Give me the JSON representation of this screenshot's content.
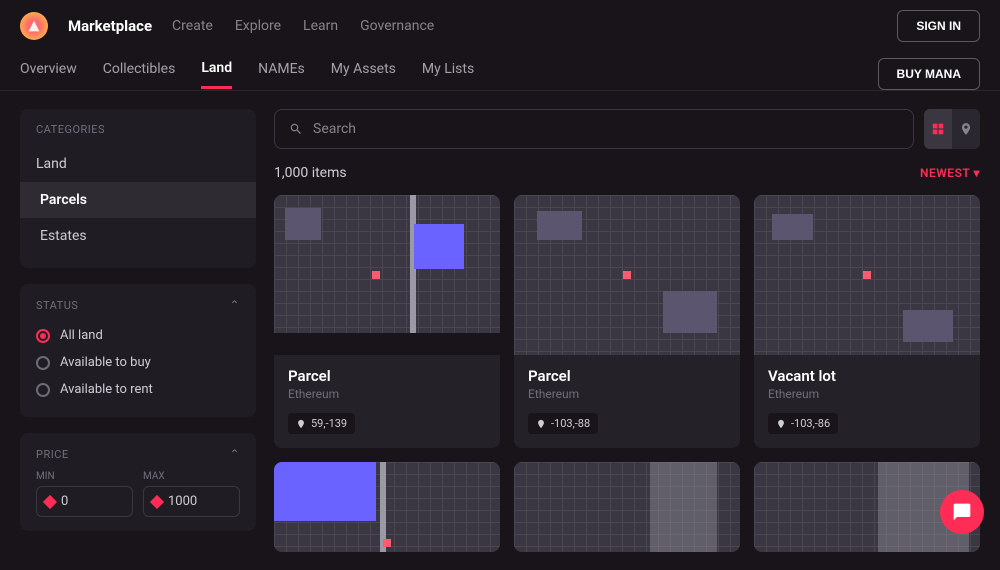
{
  "header": {
    "brand": "Marketplace",
    "nav": [
      "Create",
      "Explore",
      "Learn",
      "Governance"
    ],
    "signin": "SIGN IN"
  },
  "subnav": {
    "tabs": [
      "Overview",
      "Collectibles",
      "Land",
      "NAMEs",
      "My Assets",
      "My Lists"
    ],
    "active": "Land",
    "buy": "BUY MANA"
  },
  "sidebar": {
    "categories_title": "CATEGORIES",
    "categories": [
      {
        "label": "Land",
        "active": false
      },
      {
        "label": "Parcels",
        "active": true
      },
      {
        "label": "Estates",
        "active": false
      }
    ],
    "status_title": "STATUS",
    "status_options": [
      {
        "label": "All land",
        "selected": true
      },
      {
        "label": "Available to buy",
        "selected": false
      },
      {
        "label": "Available to rent",
        "selected": false
      }
    ],
    "price_title": "PRICE",
    "price_min_label": "MIN",
    "price_max_label": "MAX",
    "price_min": "0",
    "price_max": "1000"
  },
  "search": {
    "placeholder": "Search"
  },
  "results": {
    "count": "1,000 items",
    "sort": "NEWEST"
  },
  "cards": [
    {
      "title": "Parcel",
      "chain": "Ethereum",
      "coord": "59,-139"
    },
    {
      "title": "Parcel",
      "chain": "Ethereum",
      "coord": "-103,-88"
    },
    {
      "title": "Vacant lot",
      "chain": "Ethereum",
      "coord": "-103,-86"
    }
  ]
}
